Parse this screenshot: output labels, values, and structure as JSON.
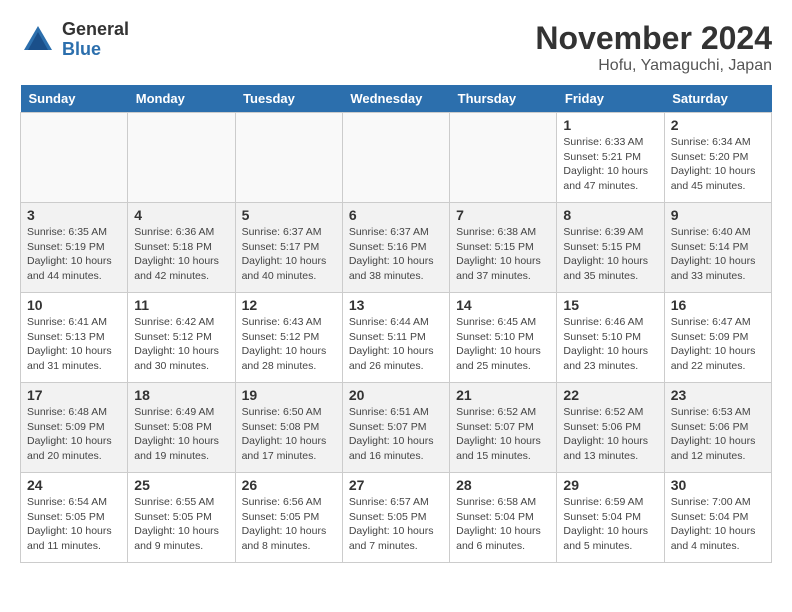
{
  "header": {
    "logo_general": "General",
    "logo_blue": "Blue",
    "title": "November 2024",
    "subtitle": "Hofu, Yamaguchi, Japan"
  },
  "weekdays": [
    "Sunday",
    "Monday",
    "Tuesday",
    "Wednesday",
    "Thursday",
    "Friday",
    "Saturday"
  ],
  "weeks": [
    [
      {
        "day": "",
        "info": ""
      },
      {
        "day": "",
        "info": ""
      },
      {
        "day": "",
        "info": ""
      },
      {
        "day": "",
        "info": ""
      },
      {
        "day": "",
        "info": ""
      },
      {
        "day": "1",
        "info": "Sunrise: 6:33 AM\nSunset: 5:21 PM\nDaylight: 10 hours and 47 minutes."
      },
      {
        "day": "2",
        "info": "Sunrise: 6:34 AM\nSunset: 5:20 PM\nDaylight: 10 hours and 45 minutes."
      }
    ],
    [
      {
        "day": "3",
        "info": "Sunrise: 6:35 AM\nSunset: 5:19 PM\nDaylight: 10 hours and 44 minutes."
      },
      {
        "day": "4",
        "info": "Sunrise: 6:36 AM\nSunset: 5:18 PM\nDaylight: 10 hours and 42 minutes."
      },
      {
        "day": "5",
        "info": "Sunrise: 6:37 AM\nSunset: 5:17 PM\nDaylight: 10 hours and 40 minutes."
      },
      {
        "day": "6",
        "info": "Sunrise: 6:37 AM\nSunset: 5:16 PM\nDaylight: 10 hours and 38 minutes."
      },
      {
        "day": "7",
        "info": "Sunrise: 6:38 AM\nSunset: 5:15 PM\nDaylight: 10 hours and 37 minutes."
      },
      {
        "day": "8",
        "info": "Sunrise: 6:39 AM\nSunset: 5:15 PM\nDaylight: 10 hours and 35 minutes."
      },
      {
        "day": "9",
        "info": "Sunrise: 6:40 AM\nSunset: 5:14 PM\nDaylight: 10 hours and 33 minutes."
      }
    ],
    [
      {
        "day": "10",
        "info": "Sunrise: 6:41 AM\nSunset: 5:13 PM\nDaylight: 10 hours and 31 minutes."
      },
      {
        "day": "11",
        "info": "Sunrise: 6:42 AM\nSunset: 5:12 PM\nDaylight: 10 hours and 30 minutes."
      },
      {
        "day": "12",
        "info": "Sunrise: 6:43 AM\nSunset: 5:12 PM\nDaylight: 10 hours and 28 minutes."
      },
      {
        "day": "13",
        "info": "Sunrise: 6:44 AM\nSunset: 5:11 PM\nDaylight: 10 hours and 26 minutes."
      },
      {
        "day": "14",
        "info": "Sunrise: 6:45 AM\nSunset: 5:10 PM\nDaylight: 10 hours and 25 minutes."
      },
      {
        "day": "15",
        "info": "Sunrise: 6:46 AM\nSunset: 5:10 PM\nDaylight: 10 hours and 23 minutes."
      },
      {
        "day": "16",
        "info": "Sunrise: 6:47 AM\nSunset: 5:09 PM\nDaylight: 10 hours and 22 minutes."
      }
    ],
    [
      {
        "day": "17",
        "info": "Sunrise: 6:48 AM\nSunset: 5:09 PM\nDaylight: 10 hours and 20 minutes."
      },
      {
        "day": "18",
        "info": "Sunrise: 6:49 AM\nSunset: 5:08 PM\nDaylight: 10 hours and 19 minutes."
      },
      {
        "day": "19",
        "info": "Sunrise: 6:50 AM\nSunset: 5:08 PM\nDaylight: 10 hours and 17 minutes."
      },
      {
        "day": "20",
        "info": "Sunrise: 6:51 AM\nSunset: 5:07 PM\nDaylight: 10 hours and 16 minutes."
      },
      {
        "day": "21",
        "info": "Sunrise: 6:52 AM\nSunset: 5:07 PM\nDaylight: 10 hours and 15 minutes."
      },
      {
        "day": "22",
        "info": "Sunrise: 6:52 AM\nSunset: 5:06 PM\nDaylight: 10 hours and 13 minutes."
      },
      {
        "day": "23",
        "info": "Sunrise: 6:53 AM\nSunset: 5:06 PM\nDaylight: 10 hours and 12 minutes."
      }
    ],
    [
      {
        "day": "24",
        "info": "Sunrise: 6:54 AM\nSunset: 5:05 PM\nDaylight: 10 hours and 11 minutes."
      },
      {
        "day": "25",
        "info": "Sunrise: 6:55 AM\nSunset: 5:05 PM\nDaylight: 10 hours and 9 minutes."
      },
      {
        "day": "26",
        "info": "Sunrise: 6:56 AM\nSunset: 5:05 PM\nDaylight: 10 hours and 8 minutes."
      },
      {
        "day": "27",
        "info": "Sunrise: 6:57 AM\nSunset: 5:05 PM\nDaylight: 10 hours and 7 minutes."
      },
      {
        "day": "28",
        "info": "Sunrise: 6:58 AM\nSunset: 5:04 PM\nDaylight: 10 hours and 6 minutes."
      },
      {
        "day": "29",
        "info": "Sunrise: 6:59 AM\nSunset: 5:04 PM\nDaylight: 10 hours and 5 minutes."
      },
      {
        "day": "30",
        "info": "Sunrise: 7:00 AM\nSunset: 5:04 PM\nDaylight: 10 hours and 4 minutes."
      }
    ]
  ]
}
